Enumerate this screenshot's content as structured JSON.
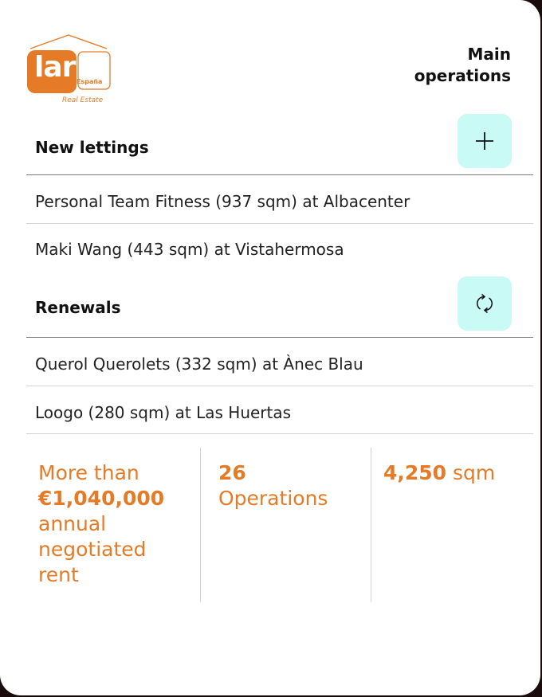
{
  "logo": {
    "word": "lar",
    "country": "España",
    "subtitle": "Real Estate"
  },
  "header": {
    "title": "Main operations"
  },
  "new_lettings": {
    "heading": "New lettings",
    "button_icon": "plus-icon",
    "items": [
      "Personal Team Fitness (937 sqm) at Albacenter",
      "Maki Wang (443  sqm) at Vistahermosa"
    ]
  },
  "renewals": {
    "heading": "Renewals",
    "button_icon": "refresh-icon",
    "items": [
      "Querol Querolets (332 sqm) at Ànec Blau",
      "Loogo (280 sqm) at Las Huertas"
    ]
  },
  "stats": {
    "rent": {
      "prefix": "More than",
      "value": "€1,040,000",
      "suffix": "annual negotiated rent"
    },
    "operations": {
      "value": "26",
      "label": "Operations"
    },
    "area": {
      "value": "4,250",
      "unit": "sqm"
    }
  },
  "colors": {
    "accent": "#e57b26",
    "button_bg": "#cafaf6"
  }
}
